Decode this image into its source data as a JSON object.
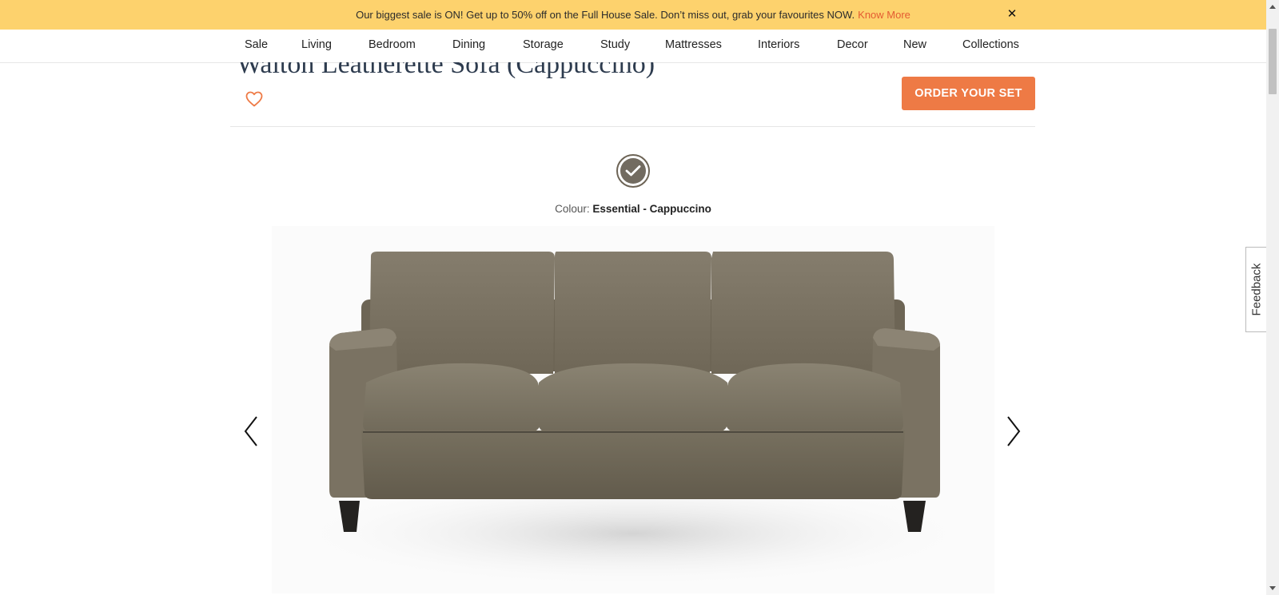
{
  "promo": {
    "text": "Our biggest sale is ON! Get up to 50% off on the Full House Sale. Don’t miss out, grab your favourites NOW.",
    "link_label": "Know More",
    "close_icon": "close-icon"
  },
  "nav": {
    "items": [
      "Sale",
      "Living",
      "Bedroom",
      "Dining",
      "Storage",
      "Study",
      "Mattresses",
      "Interiors",
      "Decor",
      "New",
      "Collections"
    ]
  },
  "product": {
    "title": "Walton Leatherette Sofa (Cappuccino)",
    "wishlist_icon": "heart-icon",
    "order_button": "ORDER YOUR SET",
    "colour_label": "Colour:",
    "colour_value": "Essential - Cappuccino",
    "swatch_color": "#726b60",
    "sofa_color": "#7a7262"
  },
  "gallery": {
    "prev_icon": "chevron-left-icon",
    "next_icon": "chevron-right-icon"
  },
  "feedback": {
    "label": "Feedback"
  },
  "colors": {
    "promo_bg": "#fdd26d",
    "accent": "#ee7a45",
    "link": "#e45c32",
    "title": "#2d3b4e"
  }
}
